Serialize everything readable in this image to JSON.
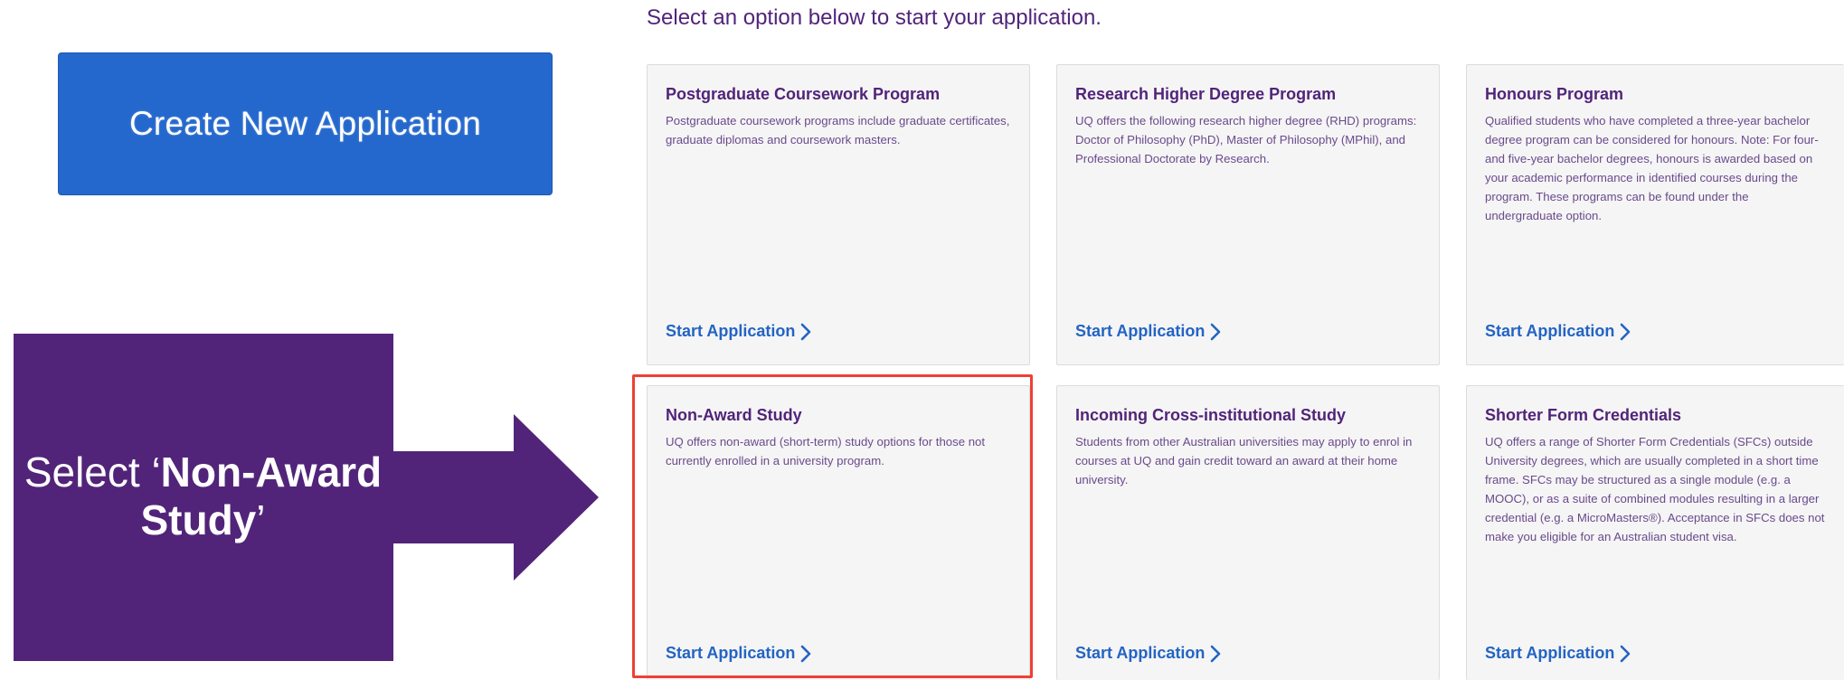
{
  "create_button": {
    "label": "Create New Application"
  },
  "heading": "Select an option below to start your application.",
  "cards": [
    {
      "title": "Postgraduate Coursework Program",
      "description": "Postgraduate coursework programs include graduate certificates, graduate diplomas and coursework masters.",
      "link": "Start Application"
    },
    {
      "title": "Research Higher Degree Program",
      "description": "UQ offers the following research higher degree (RHD) programs: Doctor of Philosophy (PhD), Master of Philosophy (MPhil), and Professional Doctorate by Research.",
      "link": "Start Application"
    },
    {
      "title": "Honours Program",
      "description": "Qualified students who have completed a three-year bachelor degree program can be considered for honours. Note: For four- and five-year bachelor degrees, honours is awarded based on your academic performance in identified courses during the program. These programs can be found under the undergraduate option.",
      "link": "Start Application"
    },
    {
      "title": "Non-Award Study",
      "description": "UQ offers non-award (short-term) study options for those not currently enrolled in a university program.",
      "link": "Start Application"
    },
    {
      "title": "Incoming Cross-institutional Study",
      "description": "Students from other Australian universities may apply to enrol in courses at UQ and gain credit toward an award at their home university.",
      "link": "Start Application"
    },
    {
      "title": "Shorter Form Credentials",
      "description": "UQ offers a range of Shorter Form Credentials (SFCs) outside University degrees, which are usually completed in a short time frame. SFCs may be structured as a single module (e.g. a MOOC), or as a suite of combined modules resulting in a larger credential (e.g. a MicroMasters®). Acceptance in SFCs does not make you eligible for an Australian student visa.",
      "link": "Start Application"
    }
  ],
  "callout": {
    "prefix": "Select ‘",
    "bold": "Non-Award Study",
    "suffix": "’"
  },
  "colors": {
    "button_blue": "#2468cd",
    "uq_purple": "#51247a",
    "link_blue": "#2364c4",
    "highlight_red": "#ee4035",
    "callout_purple": "#51247a"
  },
  "icons": {
    "link_chevron": "chevron-right-icon"
  }
}
